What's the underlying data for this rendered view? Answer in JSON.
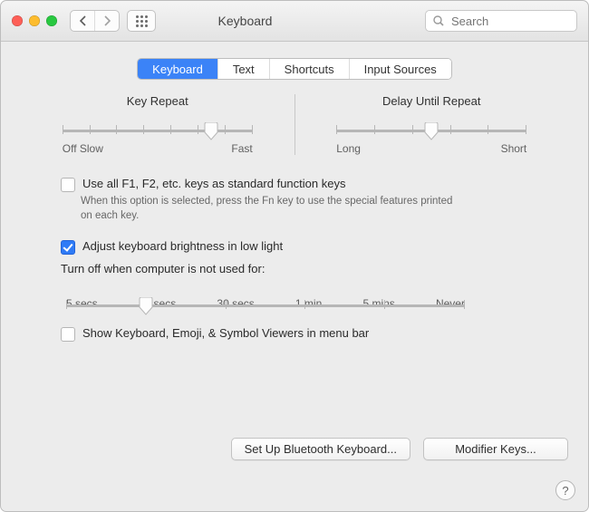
{
  "window": {
    "title": "Keyboard"
  },
  "toolbar": {
    "search_placeholder": "Search",
    "back_enabled": true,
    "forward_enabled": false
  },
  "tabs": {
    "items": [
      {
        "label": "Keyboard",
        "active": true
      },
      {
        "label": "Text",
        "active": false
      },
      {
        "label": "Shortcuts",
        "active": false
      },
      {
        "label": "Input Sources",
        "active": false
      }
    ]
  },
  "key_repeat": {
    "title": "Key Repeat",
    "left_label": "Off Slow",
    "right_label": "Fast",
    "ticks": 8,
    "value_percent": 78
  },
  "delay_until_repeat": {
    "title": "Delay Until Repeat",
    "left_label": "Long",
    "right_label": "Short",
    "ticks": 6,
    "value_percent": 50
  },
  "options": {
    "use_function_keys": {
      "checked": false,
      "label": "Use all F1, F2, etc. keys as standard function keys",
      "help": "When this option is selected, press the Fn key to use the special features printed on each key."
    },
    "adjust_brightness": {
      "checked": true,
      "label": "Adjust keyboard brightness in low light"
    },
    "idle_off": {
      "label": "Turn off when computer is not used for:",
      "ticks": [
        "5 secs",
        "10 secs",
        "30 secs",
        "1 min",
        "5 mins",
        "Never"
      ],
      "value_percent": 20
    },
    "show_viewers": {
      "checked": false,
      "label": "Show Keyboard, Emoji, & Symbol Viewers in menu bar"
    }
  },
  "buttons": {
    "bluetooth": "Set Up Bluetooth Keyboard...",
    "modifier": "Modifier Keys..."
  },
  "help_button": "?"
}
